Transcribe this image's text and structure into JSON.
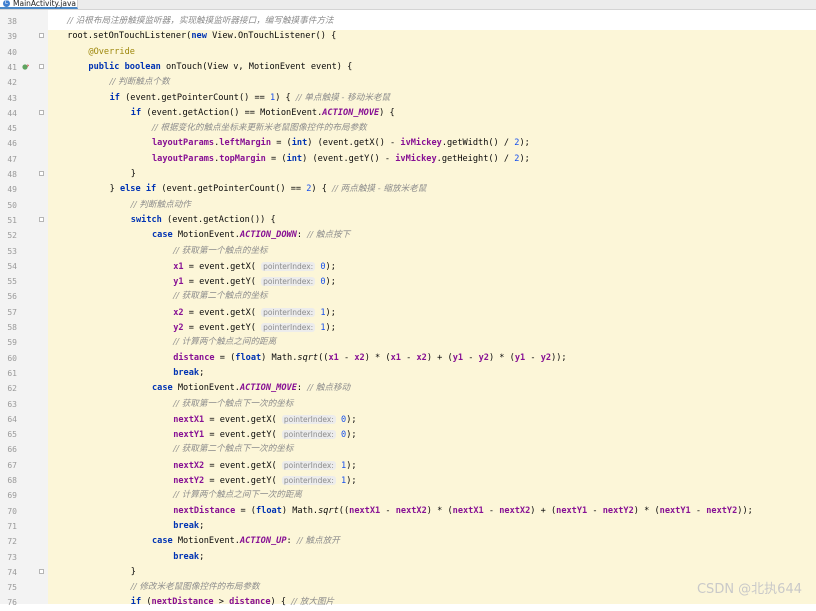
{
  "tab": {
    "filename": "MainActivity.java",
    "icon": "java-class-icon"
  },
  "watermark": "CSDN @北执644",
  "lines": [
    {
      "num": "38",
      "indent": 4,
      "fold": false,
      "gutter": "",
      "segments": [
        {
          "t": "// 沿根布局注册触摸监听器，实现触摸监听器接口，编写触摸事件方法",
          "c": "cmt"
        }
      ]
    },
    {
      "num": "39",
      "indent": 4,
      "fold": true,
      "gutter": "",
      "segments": [
        {
          "t": "root.setOnTouchListener(",
          "c": ""
        },
        {
          "t": "new",
          "c": "kw"
        },
        {
          "t": " View.OnTouchListener() {",
          "c": ""
        }
      ]
    },
    {
      "num": "40",
      "indent": 8,
      "fold": false,
      "gutter": "",
      "segments": [
        {
          "t": "@Override",
          "c": "ann"
        }
      ]
    },
    {
      "num": "41",
      "indent": 8,
      "fold": true,
      "gutter": "override-icon",
      "segments": [
        {
          "t": "public boolean",
          "c": "kw"
        },
        {
          "t": " onTouch(View v, MotionEvent event) {",
          "c": ""
        }
      ]
    },
    {
      "num": "42",
      "indent": 12,
      "fold": false,
      "gutter": "",
      "segments": [
        {
          "t": "// 判断触点个数",
          "c": "cmt"
        }
      ]
    },
    {
      "num": "43",
      "indent": 12,
      "fold": false,
      "gutter": "",
      "segments": [
        {
          "t": "if",
          "c": "kw"
        },
        {
          "t": " (event.getPointerCount() == ",
          "c": ""
        },
        {
          "t": "1",
          "c": "num"
        },
        {
          "t": ") { ",
          "c": ""
        },
        {
          "t": "// 单点触摸 - 移动米老鼠",
          "c": "cmt"
        }
      ]
    },
    {
      "num": "44",
      "indent": 16,
      "fold": true,
      "gutter": "",
      "segments": [
        {
          "t": "if",
          "c": "kw"
        },
        {
          "t": " (event.getAction() == MotionEvent.",
          "c": ""
        },
        {
          "t": "ACTION_MOVE",
          "c": "cst"
        },
        {
          "t": ") {",
          "c": ""
        }
      ]
    },
    {
      "num": "45",
      "indent": 20,
      "fold": false,
      "gutter": "",
      "segments": [
        {
          "t": "// 根据变化的触点坐标来更新米老鼠图像控件的布局参数",
          "c": "cmt"
        }
      ]
    },
    {
      "num": "46",
      "indent": 20,
      "fold": false,
      "gutter": "",
      "segments": [
        {
          "t": "layoutParams",
          "c": "fld"
        },
        {
          "t": ".",
          "c": ""
        },
        {
          "t": "leftMargin",
          "c": "fld"
        },
        {
          "t": " = (",
          "c": ""
        },
        {
          "t": "int",
          "c": "kw"
        },
        {
          "t": ") (event.getX() - ",
          "c": ""
        },
        {
          "t": "ivMickey",
          "c": "fld"
        },
        {
          "t": ".getWidth() / ",
          "c": ""
        },
        {
          "t": "2",
          "c": "num"
        },
        {
          "t": ");",
          "c": ""
        }
      ]
    },
    {
      "num": "47",
      "indent": 20,
      "fold": false,
      "gutter": "",
      "segments": [
        {
          "t": "layoutParams",
          "c": "fld"
        },
        {
          "t": ".",
          "c": ""
        },
        {
          "t": "topMargin",
          "c": "fld"
        },
        {
          "t": " = (",
          "c": ""
        },
        {
          "t": "int",
          "c": "kw"
        },
        {
          "t": ") (event.getY() - ",
          "c": ""
        },
        {
          "t": "ivMickey",
          "c": "fld"
        },
        {
          "t": ".getHeight() / ",
          "c": ""
        },
        {
          "t": "2",
          "c": "num"
        },
        {
          "t": ");",
          "c": ""
        }
      ]
    },
    {
      "num": "48",
      "indent": 16,
      "fold": true,
      "gutter": "",
      "segments": [
        {
          "t": "}",
          "c": ""
        }
      ]
    },
    {
      "num": "49",
      "indent": 12,
      "fold": false,
      "gutter": "",
      "segments": [
        {
          "t": "} ",
          "c": ""
        },
        {
          "t": "else if",
          "c": "kw"
        },
        {
          "t": " (event.getPointerCount() == ",
          "c": ""
        },
        {
          "t": "2",
          "c": "num"
        },
        {
          "t": ") { ",
          "c": ""
        },
        {
          "t": "// 两点触摸 - 缩放米老鼠",
          "c": "cmt"
        }
      ]
    },
    {
      "num": "50",
      "indent": 16,
      "fold": false,
      "gutter": "",
      "segments": [
        {
          "t": "// 判断触点动作",
          "c": "cmt"
        }
      ]
    },
    {
      "num": "51",
      "indent": 16,
      "fold": true,
      "gutter": "",
      "segments": [
        {
          "t": "switch",
          "c": "kw"
        },
        {
          "t": " (event.getAction()) {",
          "c": ""
        }
      ]
    },
    {
      "num": "52",
      "indent": 20,
      "fold": false,
      "gutter": "",
      "segments": [
        {
          "t": "case",
          "c": "kw"
        },
        {
          "t": " MotionEvent.",
          "c": ""
        },
        {
          "t": "ACTION_DOWN",
          "c": "cst"
        },
        {
          "t": ": ",
          "c": ""
        },
        {
          "t": "// 触点按下",
          "c": "cmt"
        }
      ]
    },
    {
      "num": "53",
      "indent": 24,
      "fold": false,
      "gutter": "",
      "segments": [
        {
          "t": "// 获取第一个触点的坐标",
          "c": "cmt"
        }
      ]
    },
    {
      "num": "54",
      "indent": 24,
      "fold": false,
      "gutter": "",
      "segments": [
        {
          "t": "x1",
          "c": "fld"
        },
        {
          "t": " = event.getX( ",
          "c": ""
        },
        {
          "t": "pointerIndex:",
          "c": "hint"
        },
        {
          "t": " ",
          "c": ""
        },
        {
          "t": "0",
          "c": "num"
        },
        {
          "t": ");",
          "c": ""
        }
      ]
    },
    {
      "num": "55",
      "indent": 24,
      "fold": false,
      "gutter": "",
      "segments": [
        {
          "t": "y1",
          "c": "fld"
        },
        {
          "t": " = event.getY( ",
          "c": ""
        },
        {
          "t": "pointerIndex:",
          "c": "hint"
        },
        {
          "t": " ",
          "c": ""
        },
        {
          "t": "0",
          "c": "num"
        },
        {
          "t": ");",
          "c": ""
        }
      ]
    },
    {
      "num": "56",
      "indent": 24,
      "fold": false,
      "gutter": "",
      "segments": [
        {
          "t": "// 获取第二个触点的坐标",
          "c": "cmt"
        }
      ]
    },
    {
      "num": "57",
      "indent": 24,
      "fold": false,
      "gutter": "",
      "segments": [
        {
          "t": "x2",
          "c": "fld"
        },
        {
          "t": " = event.getX( ",
          "c": ""
        },
        {
          "t": "pointerIndex:",
          "c": "hint"
        },
        {
          "t": " ",
          "c": ""
        },
        {
          "t": "1",
          "c": "num"
        },
        {
          "t": ");",
          "c": ""
        }
      ]
    },
    {
      "num": "58",
      "indent": 24,
      "fold": false,
      "gutter": "",
      "segments": [
        {
          "t": "y2",
          "c": "fld"
        },
        {
          "t": " = event.getY( ",
          "c": ""
        },
        {
          "t": "pointerIndex:",
          "c": "hint"
        },
        {
          "t": " ",
          "c": ""
        },
        {
          "t": "1",
          "c": "num"
        },
        {
          "t": ");",
          "c": ""
        }
      ]
    },
    {
      "num": "59",
      "indent": 24,
      "fold": false,
      "gutter": "",
      "segments": [
        {
          "t": "// 计算两个触点之间的距离",
          "c": "cmt"
        }
      ]
    },
    {
      "num": "60",
      "indent": 24,
      "fold": false,
      "gutter": "",
      "segments": [
        {
          "t": "distance",
          "c": "fld"
        },
        {
          "t": " = (",
          "c": ""
        },
        {
          "t": "float",
          "c": "kw"
        },
        {
          "t": ") Math.",
          "c": ""
        },
        {
          "t": "sqrt",
          "c": "itl"
        },
        {
          "t": "((",
          "c": ""
        },
        {
          "t": "x1",
          "c": "fld"
        },
        {
          "t": " - ",
          "c": ""
        },
        {
          "t": "x2",
          "c": "fld"
        },
        {
          "t": ") * (",
          "c": ""
        },
        {
          "t": "x1",
          "c": "fld"
        },
        {
          "t": " - ",
          "c": ""
        },
        {
          "t": "x2",
          "c": "fld"
        },
        {
          "t": ") + (",
          "c": ""
        },
        {
          "t": "y1",
          "c": "fld"
        },
        {
          "t": " - ",
          "c": ""
        },
        {
          "t": "y2",
          "c": "fld"
        },
        {
          "t": ") * (",
          "c": ""
        },
        {
          "t": "y1",
          "c": "fld"
        },
        {
          "t": " - ",
          "c": ""
        },
        {
          "t": "y2",
          "c": "fld"
        },
        {
          "t": "));",
          "c": ""
        }
      ]
    },
    {
      "num": "61",
      "indent": 24,
      "fold": false,
      "gutter": "",
      "segments": [
        {
          "t": "break",
          "c": "kw"
        },
        {
          "t": ";",
          "c": ""
        }
      ]
    },
    {
      "num": "62",
      "indent": 20,
      "fold": false,
      "gutter": "",
      "segments": [
        {
          "t": "case",
          "c": "kw"
        },
        {
          "t": " MotionEvent.",
          "c": ""
        },
        {
          "t": "ACTION_MOVE",
          "c": "cst"
        },
        {
          "t": ": ",
          "c": ""
        },
        {
          "t": "// 触点移动",
          "c": "cmt"
        }
      ]
    },
    {
      "num": "63",
      "indent": 24,
      "fold": false,
      "gutter": "",
      "segments": [
        {
          "t": "// 获取第一个触点下一次的坐标",
          "c": "cmt"
        }
      ]
    },
    {
      "num": "64",
      "indent": 24,
      "fold": false,
      "gutter": "",
      "segments": [
        {
          "t": "nextX1",
          "c": "fld"
        },
        {
          "t": " = event.getX( ",
          "c": ""
        },
        {
          "t": "pointerIndex:",
          "c": "hint"
        },
        {
          "t": " ",
          "c": ""
        },
        {
          "t": "0",
          "c": "num"
        },
        {
          "t": ");",
          "c": ""
        }
      ]
    },
    {
      "num": "65",
      "indent": 24,
      "fold": false,
      "gutter": "",
      "segments": [
        {
          "t": "nextY1",
          "c": "fld"
        },
        {
          "t": " = event.getY( ",
          "c": ""
        },
        {
          "t": "pointerIndex:",
          "c": "hint"
        },
        {
          "t": " ",
          "c": ""
        },
        {
          "t": "0",
          "c": "num"
        },
        {
          "t": ");",
          "c": ""
        }
      ]
    },
    {
      "num": "66",
      "indent": 24,
      "fold": false,
      "gutter": "",
      "segments": [
        {
          "t": "// 获取第二个触点下一次的坐标",
          "c": "cmt"
        }
      ]
    },
    {
      "num": "67",
      "indent": 24,
      "fold": false,
      "gutter": "",
      "segments": [
        {
          "t": "nextX2",
          "c": "fld"
        },
        {
          "t": " = event.getX( ",
          "c": ""
        },
        {
          "t": "pointerIndex:",
          "c": "hint"
        },
        {
          "t": " ",
          "c": ""
        },
        {
          "t": "1",
          "c": "num"
        },
        {
          "t": ");",
          "c": ""
        }
      ]
    },
    {
      "num": "68",
      "indent": 24,
      "fold": false,
      "gutter": "",
      "segments": [
        {
          "t": "nextY2",
          "c": "fld"
        },
        {
          "t": " = event.getY( ",
          "c": ""
        },
        {
          "t": "pointerIndex:",
          "c": "hint"
        },
        {
          "t": " ",
          "c": ""
        },
        {
          "t": "1",
          "c": "num"
        },
        {
          "t": ");",
          "c": ""
        }
      ]
    },
    {
      "num": "69",
      "indent": 24,
      "fold": false,
      "gutter": "",
      "segments": [
        {
          "t": "// 计算两个触点之间下一次的距离",
          "c": "cmt"
        }
      ]
    },
    {
      "num": "70",
      "indent": 24,
      "fold": false,
      "gutter": "",
      "segments": [
        {
          "t": "nextDistance",
          "c": "fld"
        },
        {
          "t": " = (",
          "c": ""
        },
        {
          "t": "float",
          "c": "kw"
        },
        {
          "t": ") Math.",
          "c": ""
        },
        {
          "t": "sqrt",
          "c": "itl"
        },
        {
          "t": "((",
          "c": ""
        },
        {
          "t": "nextX1",
          "c": "fld"
        },
        {
          "t": " - ",
          "c": ""
        },
        {
          "t": "nextX2",
          "c": "fld"
        },
        {
          "t": ") * (",
          "c": ""
        },
        {
          "t": "nextX1",
          "c": "fld"
        },
        {
          "t": " - ",
          "c": ""
        },
        {
          "t": "nextX2",
          "c": "fld"
        },
        {
          "t": ") + (",
          "c": ""
        },
        {
          "t": "nextY1",
          "c": "fld"
        },
        {
          "t": " - ",
          "c": ""
        },
        {
          "t": "nextY2",
          "c": "fld"
        },
        {
          "t": ") * (",
          "c": ""
        },
        {
          "t": "nextY1",
          "c": "fld"
        },
        {
          "t": " - ",
          "c": ""
        },
        {
          "t": "nextY2",
          "c": "fld"
        },
        {
          "t": "));",
          "c": ""
        }
      ]
    },
    {
      "num": "71",
      "indent": 24,
      "fold": false,
      "gutter": "",
      "segments": [
        {
          "t": "break",
          "c": "kw"
        },
        {
          "t": ";",
          "c": ""
        }
      ]
    },
    {
      "num": "72",
      "indent": 20,
      "fold": false,
      "gutter": "",
      "segments": [
        {
          "t": "case",
          "c": "kw"
        },
        {
          "t": " MotionEvent.",
          "c": ""
        },
        {
          "t": "ACTION_UP",
          "c": "cst"
        },
        {
          "t": ": ",
          "c": ""
        },
        {
          "t": "// 触点放开",
          "c": "cmt"
        }
      ]
    },
    {
      "num": "73",
      "indent": 24,
      "fold": false,
      "gutter": "",
      "segments": [
        {
          "t": "break",
          "c": "kw"
        },
        {
          "t": ";",
          "c": ""
        }
      ]
    },
    {
      "num": "74",
      "indent": 16,
      "fold": true,
      "gutter": "",
      "segments": [
        {
          "t": "}",
          "c": ""
        }
      ]
    },
    {
      "num": "75",
      "indent": 16,
      "fold": false,
      "gutter": "",
      "segments": [
        {
          "t": "// 修改米老鼠图像控件的布局参数",
          "c": "cmt"
        }
      ]
    },
    {
      "num": "76",
      "indent": 16,
      "fold": false,
      "gutter": "",
      "segments": [
        {
          "t": "if",
          "c": "kw"
        },
        {
          "t": " (",
          "c": ""
        },
        {
          "t": "nextDistance",
          "c": "fld"
        },
        {
          "t": " > ",
          "c": ""
        },
        {
          "t": "distance",
          "c": "fld"
        },
        {
          "t": ") { ",
          "c": ""
        },
        {
          "t": "// 放大图片",
          "c": "cmt"
        }
      ]
    }
  ]
}
